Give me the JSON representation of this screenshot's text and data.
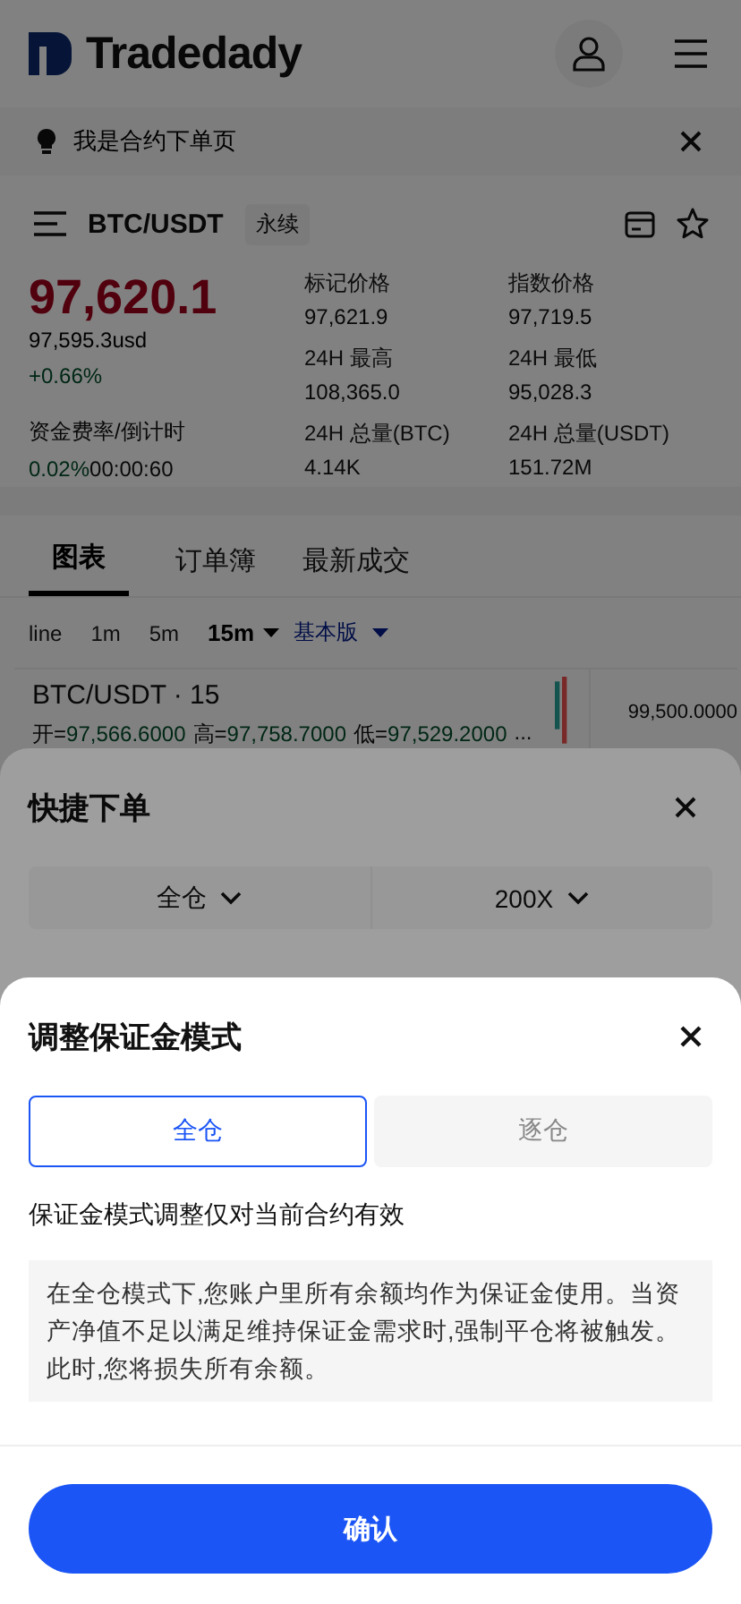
{
  "header": {
    "logo_text": "Tradedady"
  },
  "notice": {
    "text": "我是合约下单页"
  },
  "symbol": {
    "pair": "BTC/USDT",
    "tag": "永续"
  },
  "ticker": {
    "last_price": "97,620.1",
    "usd_price": "97,595.3usd",
    "change": "+0.66%",
    "funding_label": "资金费率/倒计时",
    "funding_rate": "0.02%",
    "countdown": "00:00:60",
    "stats": [
      {
        "label": "标记价格",
        "value": "97,621.9"
      },
      {
        "label": "指数价格",
        "value": "97,719.5"
      },
      {
        "label": "24H 最高",
        "value": "108,365.0"
      },
      {
        "label": "24H 最低",
        "value": "95,028.3"
      },
      {
        "label": "24H 总量(BTC)",
        "value": "4.14K"
      },
      {
        "label": "24H 总量(USDT)",
        "value": "151.72M"
      }
    ]
  },
  "tabs": [
    {
      "label": "图表",
      "selected": true
    },
    {
      "label": "订单簿",
      "selected": false
    },
    {
      "label": "最新成交",
      "selected": false
    }
  ],
  "chart_toolbar": [
    {
      "label": "line",
      "kind": "interval",
      "selected": false
    },
    {
      "label": "1m",
      "kind": "interval",
      "selected": false
    },
    {
      "label": "5m",
      "kind": "interval",
      "selected": false
    },
    {
      "label": "15m",
      "kind": "dropdown",
      "selected": true
    },
    {
      "label": "基本版",
      "kind": "version",
      "selected": false
    }
  ],
  "chart": {
    "title": "BTC/USDT · 15",
    "ohlc": [
      {
        "label": "开=",
        "value": "97,566.6000"
      },
      {
        "label": "高=",
        "value": "97,758.7000"
      },
      {
        "label": "低=",
        "value": "97,529.2000"
      }
    ],
    "more": "...",
    "price_label": "99,500.0000"
  },
  "quick_order": {
    "title": "快捷下单",
    "margin_mode": "全仓",
    "leverage": "200X"
  },
  "margin_sheet": {
    "title": "调整保证金模式",
    "options": [
      {
        "label": "全仓",
        "selected": true
      },
      {
        "label": "逐仓",
        "selected": false
      }
    ],
    "note": "保证金模式调整仅对当前合约有效",
    "description": "在全仓模式下,您账户里所有余额均作为保证金使用。当资产净值不足以满足维持保证金需求时,强制平仓将被触发。此时,您将损失所有余额。",
    "confirm": "确认"
  }
}
